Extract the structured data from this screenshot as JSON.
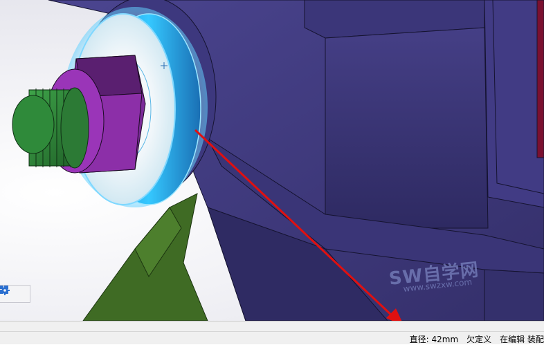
{
  "status": {
    "diameter": "直径: 42mm",
    "definition_state": "欠定义",
    "editing_context": "在编辑 装配"
  },
  "watermark": {
    "text": "SW自学网",
    "url": "www.swzxw.com"
  },
  "viewport_toolbar": {
    "buttons": [
      "view-orientation-icon",
      "settings-icon"
    ]
  },
  "colors": {
    "part_purple": "#3f3a7a",
    "selected_face": "#29c2ff",
    "washer_edge": "#7fd8ff",
    "nut_magenta": "#8c2fa8",
    "bolt_green": "#2f8a3a",
    "ground_green": "#3f6b24",
    "arrow_red": "#e01010"
  }
}
